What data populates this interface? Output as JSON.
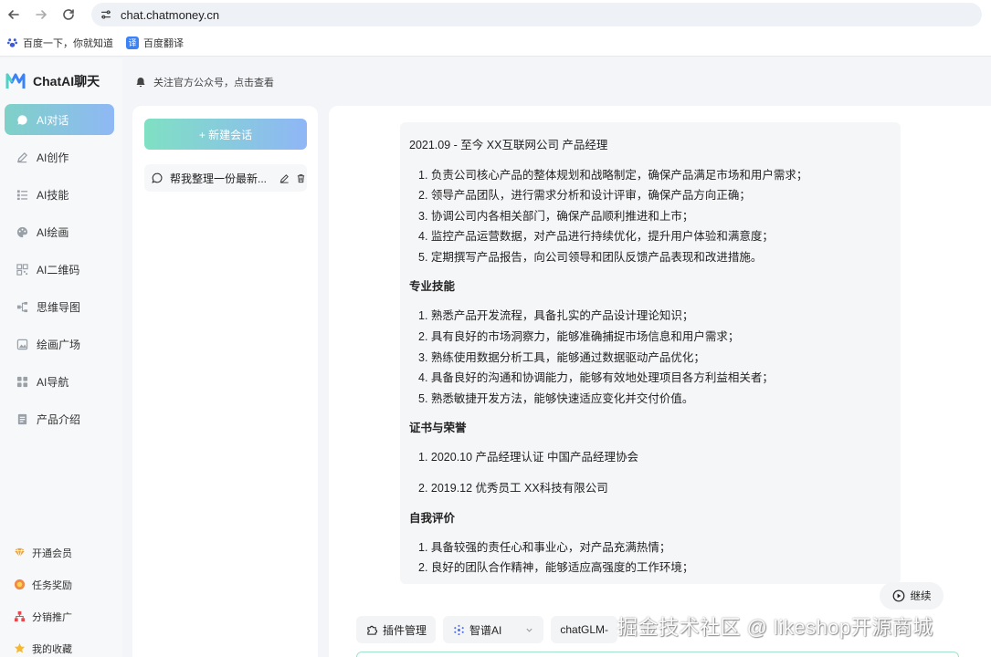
{
  "browser": {
    "url": "chat.chatmoney.cn",
    "bookmarks": [
      "百度一下，你就知道",
      "百度翻译"
    ]
  },
  "app": {
    "name": "ChatAI聊天",
    "notice": "关注官方公众号，点击查看"
  },
  "sidebar": {
    "items": [
      {
        "label": "AI对话",
        "icon": "chat-icon",
        "active": true
      },
      {
        "label": "AI创作",
        "icon": "pen-icon"
      },
      {
        "label": "AI技能",
        "icon": "list-icon"
      },
      {
        "label": "AI绘画",
        "icon": "palette-icon"
      },
      {
        "label": "AI二维码",
        "icon": "qrcode-icon"
      },
      {
        "label": "思维导图",
        "icon": "mindmap-icon"
      },
      {
        "label": "绘画广场",
        "icon": "image-icon"
      },
      {
        "label": "AI导航",
        "icon": "grid-icon"
      },
      {
        "label": "产品介绍",
        "icon": "document-icon"
      }
    ],
    "bottom": [
      {
        "label": "开通会员",
        "icon": "vip-icon"
      },
      {
        "label": "任务奖励",
        "icon": "reward-icon"
      },
      {
        "label": "分销推广",
        "icon": "share-tree-icon"
      },
      {
        "label": "我的收藏",
        "icon": "star-icon"
      }
    ]
  },
  "chat_list": {
    "new_chat": "+ 新建会话",
    "items": [
      {
        "title": "帮我整理一份最新..."
      }
    ]
  },
  "message": {
    "head": "2021.09 - 至今 XX互联网公司 产品经理",
    "block1": [
      "1. 负责公司核心产品的整体规划和战略制定，确保产品满足市场和用户需求；",
      "2. 领导产品团队，进行需求分析和设计评审，确保产品方向正确；",
      "3. 协调公司内各相关部门，确保产品顺利推进和上市；",
      "4. 监控产品运营数据，对产品进行持续优化，提升用户体验和满意度；",
      "5. 定期撰写产品报告，向公司领导和团队反馈产品表现和改进措施。"
    ],
    "section2": "专业技能",
    "block2": [
      "1. 熟悉产品开发流程，具备扎实的产品设计理论知识；",
      "2. 具有良好的市场洞察力，能够准确捕捉市场信息和用户需求；",
      "3. 熟练使用数据分析工具，能够通过数据驱动产品优化；",
      "4. 具备良好的沟通和协调能力，能够有效地处理项目各方利益相关者；",
      "5. 熟悉敏捷开发方法，能够快速适应变化并交付价值。"
    ],
    "section3": "证书与荣誉",
    "block3": [
      "1. 2020.10 产品经理认证 中国产品经理协会",
      "2. 2019.12 优秀员工 XX科技有限公司"
    ],
    "section4": "自我评价",
    "block4": [
      "1. 具备较强的责任心和事业心，对产品充满热情；",
      "2. 良好的团队合作精神，能够适应高强度的工作环境；"
    ]
  },
  "continue": "继续",
  "toolbar": {
    "plugins": "插件管理",
    "model": "智谱AI",
    "submodel": "chatGLM-"
  },
  "watermark": "掘金技术社区 @ likeshop开源商城"
}
